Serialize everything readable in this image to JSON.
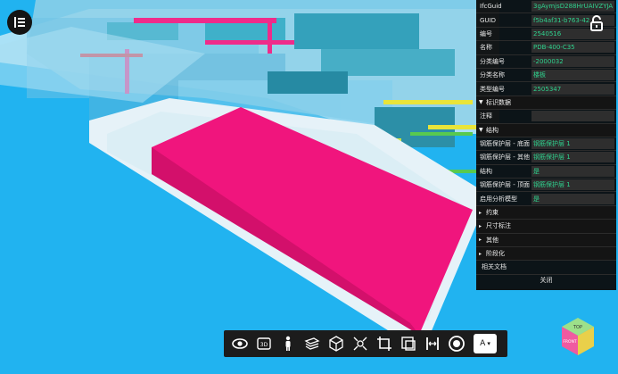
{
  "properties": {
    "rows_top": [
      {
        "key": "IfcGuid",
        "value": "3gAymjsD288HrUAIVZYJA"
      },
      {
        "key": "GUID",
        "value": "f5b4af31-b763-42"
      },
      {
        "key": "编号",
        "value": "2540516"
      },
      {
        "key": "名称",
        "value": "PDB-400-C35"
      },
      {
        "key": "分类编号",
        "value": "-2000032"
      },
      {
        "key": "分类名称",
        "value": "楼板"
      },
      {
        "key": "类型编号",
        "value": "2505347"
      }
    ],
    "sections": {
      "identity": "标识数据",
      "structure": "结构",
      "constraints": "约束",
      "dimensions": "尺寸标注",
      "other": "其他",
      "phasing": "阶段化"
    },
    "identity_rows": [
      {
        "key": "注释",
        "value": ""
      }
    ],
    "structure_rows": [
      {
        "key": "钢筋保护层 - 底面",
        "value": "钢筋保护层 1"
      },
      {
        "key": "钢筋保护层 - 其他",
        "value": "钢筋保护层 1"
      },
      {
        "key": "结构",
        "value": "是"
      },
      {
        "key": "钢筋保护层 - 顶面",
        "value": "钢筋保护层 1"
      },
      {
        "key": "启用分析模型",
        "value": "是"
      }
    ],
    "related_docs": "相关文档",
    "close_label": "关闭"
  },
  "toolbar": {
    "tools": [
      "eye-icon",
      "3d-view-icon",
      "person-icon",
      "layers-icon",
      "box-icon",
      "explode-icon",
      "crop-icon",
      "section-box-icon",
      "measure-icon",
      "target-icon"
    ],
    "select_value": "A"
  },
  "viewcube": {
    "top_label": "TOP",
    "front_label": "FRONT",
    "colors": {
      "top": "#9de08a",
      "front": "#f05aa0",
      "right": "#e9d04a"
    }
  },
  "colors": {
    "sky": "#21b3f0",
    "selected_slab": "#f0157d",
    "slab": "#e6f2f8",
    "panel_bg": "#0c0c0c",
    "value_text": "#2fd28e"
  }
}
